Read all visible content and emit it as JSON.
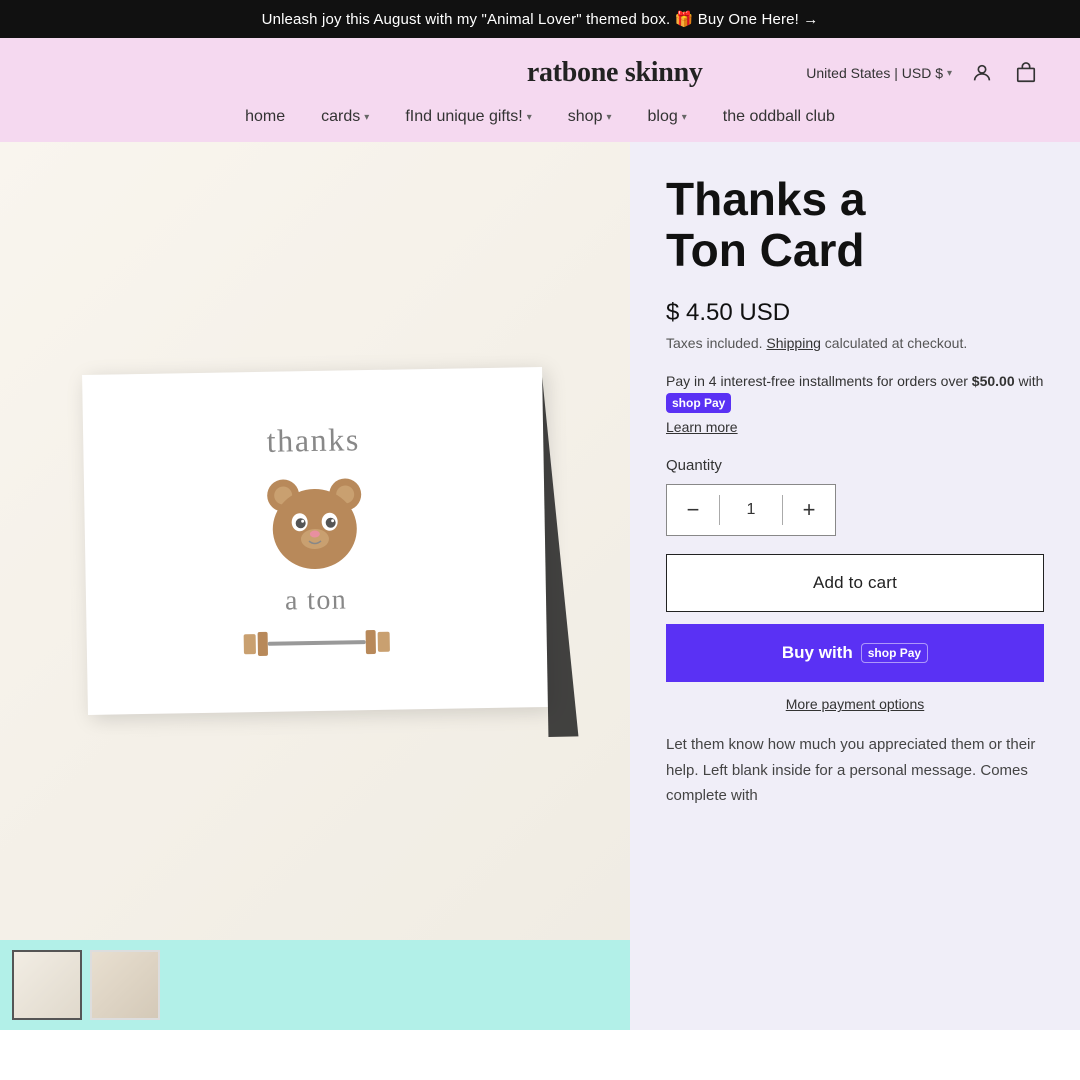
{
  "announcement": {
    "text": "Unleash joy this August with my \"Animal Lover\" themed box. 🎁 Buy One Here! →"
  },
  "header": {
    "logo": "ratbone skinny",
    "country_selector": "United States | USD $",
    "login_icon": "person-icon",
    "cart_icon": "cart-icon"
  },
  "nav": {
    "items": [
      {
        "label": "home",
        "has_dropdown": false
      },
      {
        "label": "cards",
        "has_dropdown": true
      },
      {
        "label": "fInd unique gifts!",
        "has_dropdown": true
      },
      {
        "label": "shop",
        "has_dropdown": true
      },
      {
        "label": "blog",
        "has_dropdown": true
      },
      {
        "label": "the oddball club",
        "has_dropdown": false
      }
    ]
  },
  "product": {
    "title_line1": "Thanks a",
    "title_line2": "Ton Card",
    "price": "$ 4.50 USD",
    "price_note_prefix": "Taxes included.",
    "shipping_link": "Shipping",
    "price_note_suffix": "calculated at checkout.",
    "shop_pay_text_prefix": "Pay in 4 interest-free installments for orders over ",
    "shop_pay_amount": "$50.00",
    "shop_pay_text_suffix": "with",
    "shop_pay_badge": "shop Pay",
    "learn_more": "Learn more",
    "quantity_label": "Quantity",
    "quantity_value": "1",
    "decrease_btn": "−",
    "increase_btn": "+",
    "add_to_cart": "Add to cart",
    "buy_now": "Buy with",
    "buy_now_badge": "shop Pay",
    "more_payment": "More payment options",
    "description": "Let them know how much you appreciated them or their help. Left blank inside for a personal message. Comes complete with"
  }
}
